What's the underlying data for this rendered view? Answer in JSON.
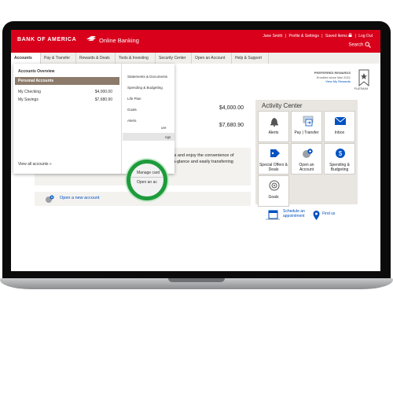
{
  "header": {
    "logo": "BANK OF AMERICA",
    "title": "Online Banking",
    "links": [
      "Jane Smith",
      "|",
      "Profile & Settings",
      "|",
      "Saved Items",
      "|",
      "Log Out"
    ],
    "search_label": "Search"
  },
  "nav": {
    "items": [
      "Accounts",
      "Pay & Transfer",
      "Rewards & Deals",
      "Tools & Investing",
      "Security Center",
      "Open an Account",
      "Help & Support"
    ]
  },
  "rewards": {
    "title": "PREFERRED REWARDS",
    "since": "Enrolled since Mar 2021",
    "link": "View My Rewards",
    "tier": "PLATINUM"
  },
  "accounts_list": {
    "amounts": [
      "$4,000.00",
      "$7,680.90"
    ]
  },
  "promo": {
    "line1": "unts and enjoy the convenience of",
    "line2": "al-a-glance and easily transferring",
    "line3": "funds between your accounts."
  },
  "open_account": {
    "label": "Open a new account"
  },
  "activity_center": {
    "title": "Activity Center",
    "tiles": {
      "alerts": "Alerts",
      "pay_transfer": "Pay | Transfer",
      "inbox": "Inbox",
      "special_offers": "Special Offers & Deals",
      "open_account": "Open an Account",
      "spending": "Spending & Budgeting",
      "goals": "Goals"
    },
    "schedule": "Schedule an appointment",
    "find_us": "Find us"
  },
  "dropdown": {
    "heading": "Accounts Overview",
    "personal": "Personal Accounts",
    "accounts": [
      {
        "name": "My Checking",
        "value": "$4,000.00"
      },
      {
        "name": "My Savings",
        "value": "$7,680.90"
      }
    ],
    "view_all": "View all accounts »",
    "menu": [
      "Statements & Documents",
      "Spending & Budgeting",
      "Life Plan",
      "Goals",
      "Alerts",
      "ure",
      "ngs"
    ],
    "highlight": [
      "Manage card",
      "Open an ac"
    ]
  },
  "colors": {
    "brand_red": "#d9001b",
    "link_blue": "#0052c2",
    "highlight_green": "#1e9b3c"
  }
}
